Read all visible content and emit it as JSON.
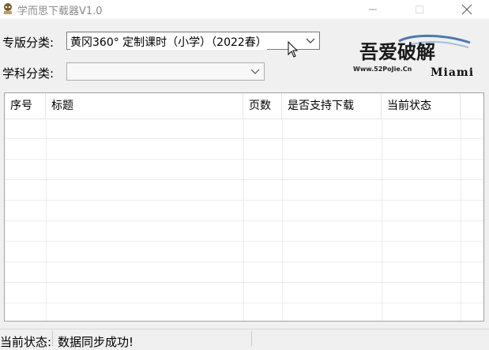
{
  "window": {
    "title": "学而思下载器V1.0"
  },
  "form": {
    "edition_label": "专版分类:",
    "edition_value": "黄冈360° 定制课时（小学）（2022春）",
    "subject_label": "学科分类:",
    "subject_value": ""
  },
  "logo": {
    "main_text": "吾爱破解",
    "url_text": "Www.52PoJie.Cn",
    "signature": "Miami"
  },
  "table": {
    "columns": [
      {
        "label": "序号"
      },
      {
        "label": "标题"
      },
      {
        "label": "页数"
      },
      {
        "label": "是否支持下载"
      },
      {
        "label": "当前状态"
      },
      {
        "label": ""
      }
    ],
    "rows": []
  },
  "status": {
    "label": "当前状态:",
    "message": "数据同步成功!"
  },
  "icons": {
    "app": "app-icon",
    "minimize": "minimize-icon",
    "maximize": "maximize-icon",
    "close": "close-icon",
    "dropdown": "chevron-down-icon",
    "cursor": "mouse-pointer-icon"
  }
}
